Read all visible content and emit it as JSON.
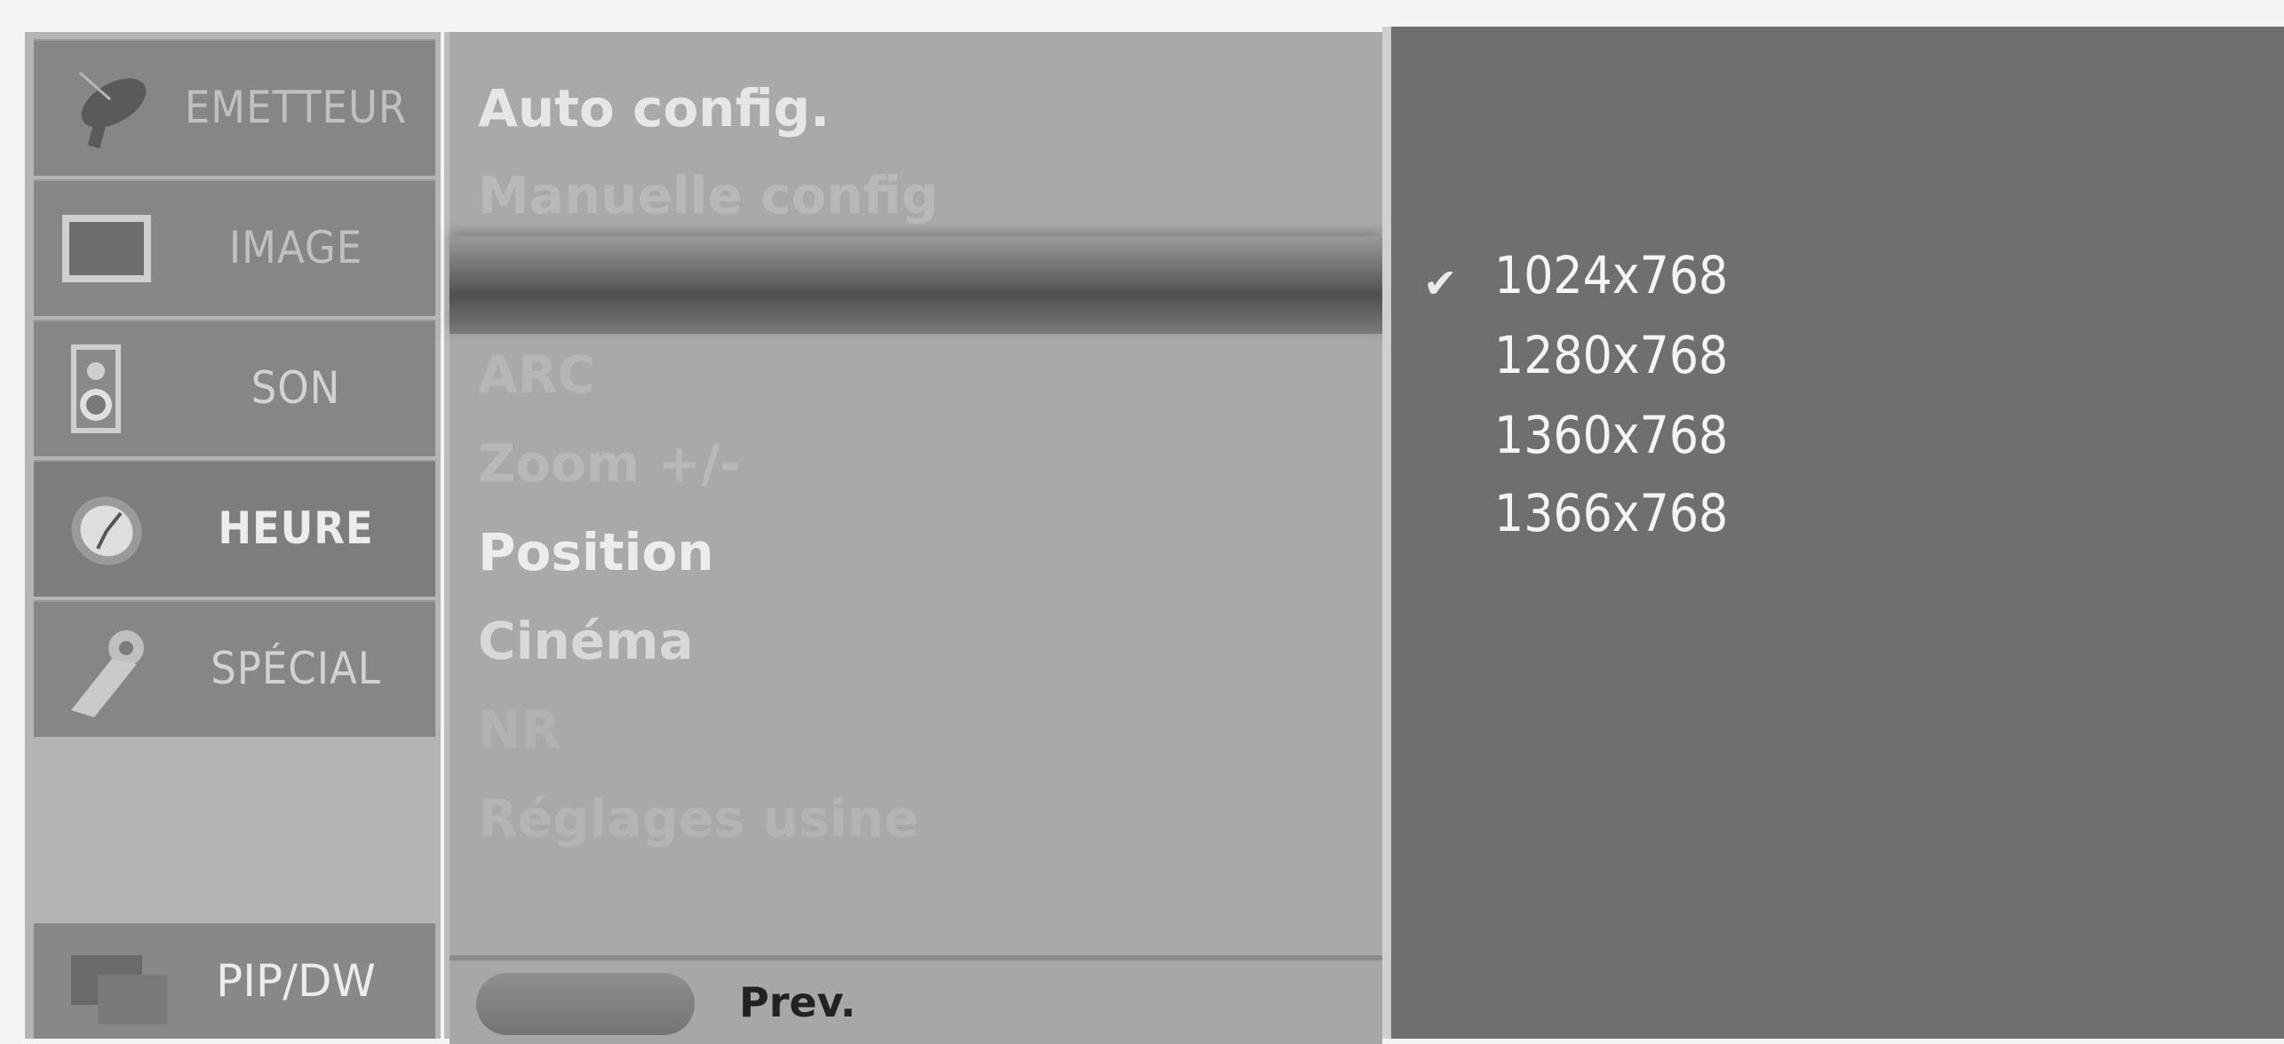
{
  "sidebar": {
    "items": [
      {
        "label": "EMETTEUR",
        "icon": "satellite-dish-icon"
      },
      {
        "label": "IMAGE",
        "icon": "screen-icon"
      },
      {
        "label": "SON",
        "icon": "speaker-icon"
      },
      {
        "label": "HEURE",
        "icon": "clock-icon"
      },
      {
        "label": "SPÉCIAL",
        "icon": "tag-key-icon"
      }
    ],
    "pip": {
      "label": "PIP/DW",
      "icon": "pip-windows-icon"
    }
  },
  "menu": {
    "items": [
      "Auto config.",
      "Manuelle config",
      "ARC",
      "Zoom +/-",
      "Position",
      "Cinéma",
      "NR",
      "Réglages usine"
    ],
    "footer_label": "Prev."
  },
  "resolutions": {
    "items": [
      "1024x768",
      "1280x768",
      "1360x768",
      "1366x768"
    ],
    "check_glyph": "✔"
  },
  "colors": {
    "bright_text": "#e8e8e8",
    "dim_text": "#bcbcbc",
    "panel_dark": "#6f6f6f"
  }
}
